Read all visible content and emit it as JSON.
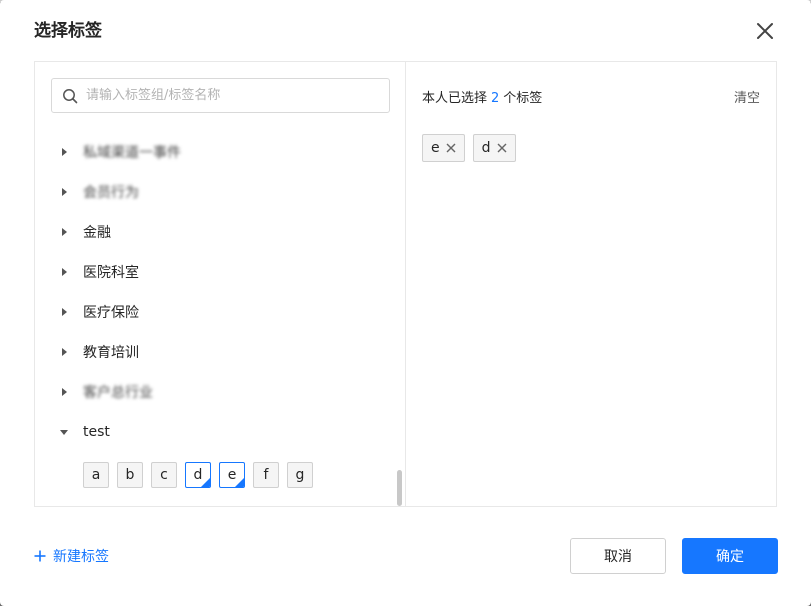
{
  "dialog": {
    "title": "选择标签",
    "close_icon": "close-icon"
  },
  "search": {
    "placeholder": "请输入标签组/标签名称",
    "value": "",
    "icon": "search-icon"
  },
  "tree": {
    "groups": [
      {
        "label": "私域渠道一事件",
        "expanded": false,
        "obscured": true
      },
      {
        "label": "会员行为",
        "expanded": false,
        "obscured": true
      },
      {
        "label": "金融",
        "expanded": false,
        "obscured": false
      },
      {
        "label": "医院科室",
        "expanded": false,
        "obscured": false
      },
      {
        "label": "医疗保险",
        "expanded": false,
        "obscured": false
      },
      {
        "label": "教育培训",
        "expanded": false,
        "obscured": false
      },
      {
        "label": "客户总行业",
        "expanded": false,
        "obscured": true
      },
      {
        "label": "test",
        "expanded": true,
        "obscured": false
      }
    ],
    "test_tags": [
      {
        "label": "a",
        "selected": false
      },
      {
        "label": "b",
        "selected": false
      },
      {
        "label": "c",
        "selected": false
      },
      {
        "label": "d",
        "selected": true
      },
      {
        "label": "e",
        "selected": true
      },
      {
        "label": "f",
        "selected": false
      },
      {
        "label": "g",
        "selected": false
      }
    ]
  },
  "summary": {
    "prefix": "本人已选择",
    "count": "2",
    "suffix": "个标签",
    "clear_label": "清空"
  },
  "selected_tags": [
    {
      "label": "e"
    },
    {
      "label": "d"
    }
  ],
  "footer": {
    "new_tag_label": "新建标签",
    "cancel_label": "取消",
    "ok_label": "确定"
  },
  "colors": {
    "accent": "#1677ff",
    "border": "#d0d0d0",
    "chip_bg": "#f5f5f5"
  }
}
